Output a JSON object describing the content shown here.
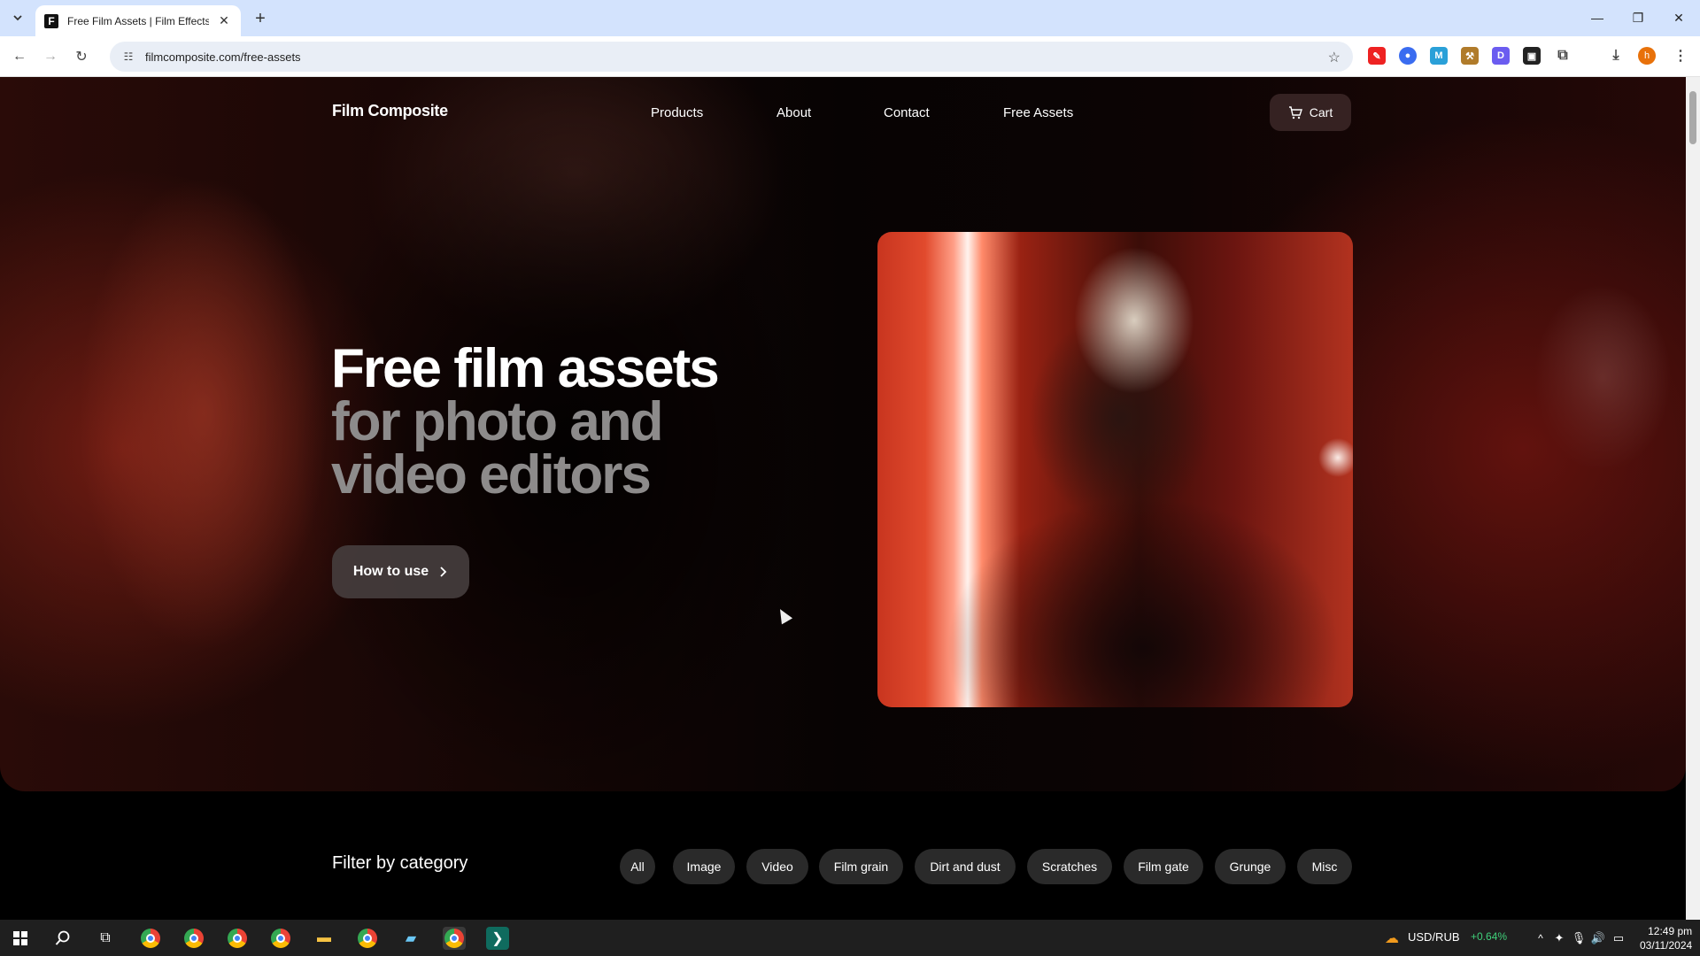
{
  "browser": {
    "tab_title": "Free Film Assets | Film Effects fo",
    "favicon_letter": "F",
    "url": "filmcomposite.com/free-assets",
    "profile_initial": "h"
  },
  "site": {
    "logo": "Film Composite",
    "nav": [
      "Products",
      "About",
      "Contact",
      "Free Assets"
    ],
    "cart_label": "Cart"
  },
  "hero": {
    "line1": "Free film assets",
    "line2": "for photo and",
    "line3": "video editors",
    "cta_label": "How to use"
  },
  "filter": {
    "title": "Filter by category",
    "categories": [
      "All",
      "Image",
      "Video",
      "Film grain",
      "Dirt and dust",
      "Scratches",
      "Film gate",
      "Grunge",
      "Misc"
    ]
  },
  "taskbar": {
    "ticker_pair": "USD/RUB",
    "ticker_change": "+0.64%",
    "time": "12:49 pm",
    "date": "03/11/2024"
  },
  "colors": {
    "ticker_positive": "#3fd07a",
    "headline_secondary": "#8d8b8b"
  }
}
